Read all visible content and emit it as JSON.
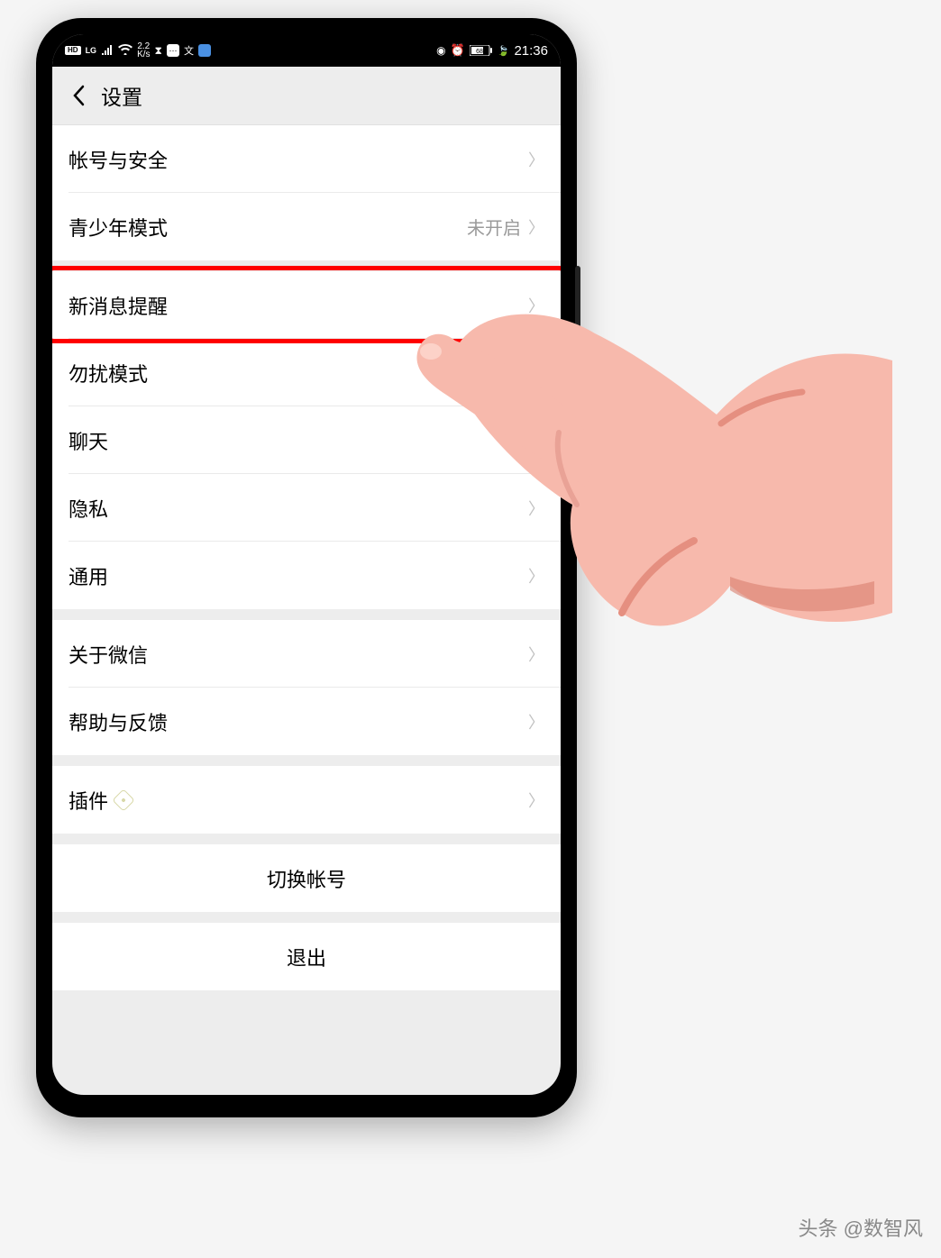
{
  "status": {
    "hd": "HD",
    "lg": "LG",
    "speed_num": "2.2",
    "speed_unit": "K/s",
    "time": "21:36",
    "battery": "68"
  },
  "header": {
    "title": "设置"
  },
  "groups": [
    {
      "items": [
        {
          "label": "帐号与安全",
          "value": ""
        },
        {
          "label": "青少年模式",
          "value": "未开启"
        }
      ]
    },
    {
      "items": [
        {
          "label": "新消息提醒",
          "value": "",
          "highlight": true
        },
        {
          "label": "勿扰模式",
          "value": ""
        },
        {
          "label": "聊天",
          "value": ""
        },
        {
          "label": "隐私",
          "value": ""
        },
        {
          "label": "通用",
          "value": ""
        }
      ]
    },
    {
      "items": [
        {
          "label": "关于微信",
          "value": ""
        },
        {
          "label": "帮助与反馈",
          "value": ""
        }
      ]
    },
    {
      "items": [
        {
          "label": "插件",
          "value": "",
          "badge": true
        }
      ]
    }
  ],
  "actions": [
    {
      "label": "切换帐号"
    },
    {
      "label": "退出"
    }
  ],
  "watermark": "头条 @数智风"
}
